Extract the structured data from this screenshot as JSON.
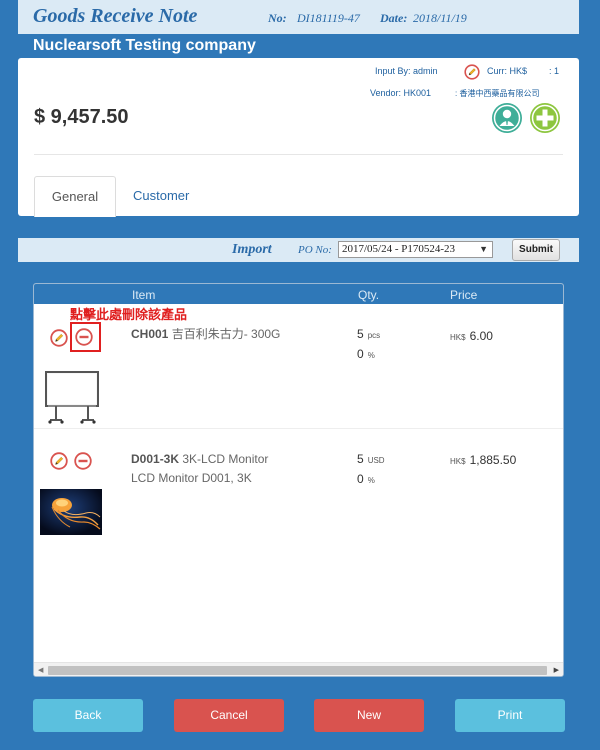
{
  "title_bar": {
    "title": "Goods Receive Note",
    "no_label": "No:",
    "no_value": "DI181119-47",
    "date_label": "Date:",
    "date_value": "2018/11/19"
  },
  "company": "Nuclearsoft Testing company",
  "info": {
    "input_by": "Input By: admin",
    "currency": "Curr: HK$",
    "rate": ": 1",
    "vendor": "Vendor: HK001",
    "vendor_name": ": 香港中西藥品有限公司",
    "amount": "$ 9,457.50"
  },
  "tabs": [
    {
      "label": "General",
      "active": true
    },
    {
      "label": "Customer",
      "active": false
    }
  ],
  "import_bar": {
    "import_label": "Import",
    "po_label": "PO No:",
    "po_selected": "2017/05/24 - P170524-23",
    "submit_label": "Submit"
  },
  "grid": {
    "headers": {
      "item": "Item",
      "qty": "Qty.",
      "price": "Price"
    },
    "annotation": "點擊此處刪除該產品",
    "rows": [
      {
        "code": "CH001",
        "desc_line1": "吉百利朱古力- 300G",
        "desc_line2": "",
        "qty": "5",
        "qty_unit": "pcs",
        "discount": "0",
        "discount_unit": "%",
        "price_currency": "HK$",
        "price": "6.00"
      },
      {
        "code": "D001-3K",
        "desc_line1": "3K-LCD Monitor",
        "desc_line2": "LCD Monitor D001, 3K",
        "qty": "5",
        "qty_unit": "USD",
        "discount": "0",
        "discount_unit": "%",
        "price_currency": "HK$",
        "price": "1,885.50"
      }
    ]
  },
  "buttons": {
    "back": "Back",
    "cancel": "Cancel",
    "new": "New",
    "print": "Print"
  },
  "colors": {
    "page_bg": "#2f78b8",
    "header_bar": "#dbeaf5",
    "info_btn": "#5bc0de",
    "danger_btn": "#d9534f",
    "highlight": "#e02020"
  }
}
